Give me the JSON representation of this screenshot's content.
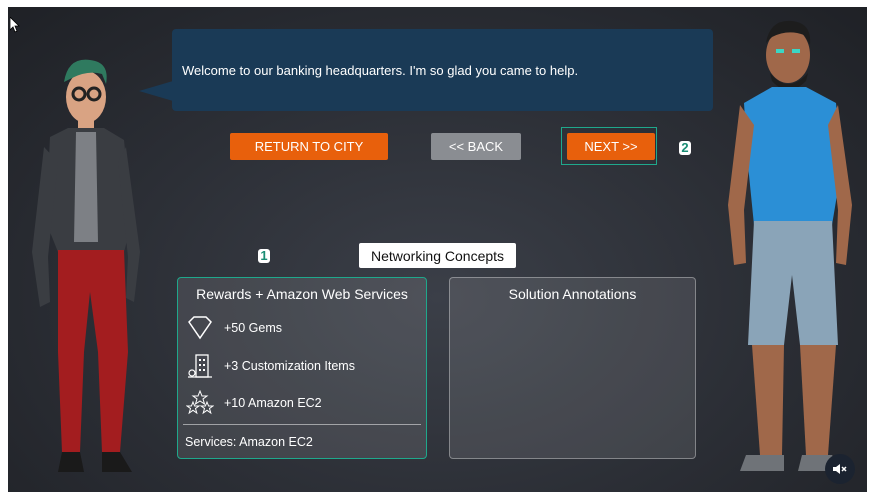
{
  "dialog": {
    "text": "Welcome to our banking headquarters. I'm so glad you came to help."
  },
  "buttons": {
    "return_label": "RETURN TO CITY",
    "back_label": "<< BACK",
    "next_label": "NEXT >>"
  },
  "badges": {
    "one": "1",
    "two": "2"
  },
  "section_title": "Networking Concepts",
  "rewards_panel": {
    "title": "Rewards + Amazon Web Services",
    "items": [
      {
        "icon": "gem-icon",
        "label": "+50 Gems"
      },
      {
        "icon": "building-icon",
        "label": "+3 Customization Items"
      },
      {
        "icon": "stars-icon",
        "label": "+10 Amazon EC2"
      }
    ],
    "services": "Services: Amazon EC2"
  },
  "solution_panel": {
    "title": "Solution Annotations"
  },
  "colors": {
    "accent_orange": "#e8600c",
    "highlight_teal": "#1fa88c",
    "dialog_blue": "#1a3a56"
  }
}
